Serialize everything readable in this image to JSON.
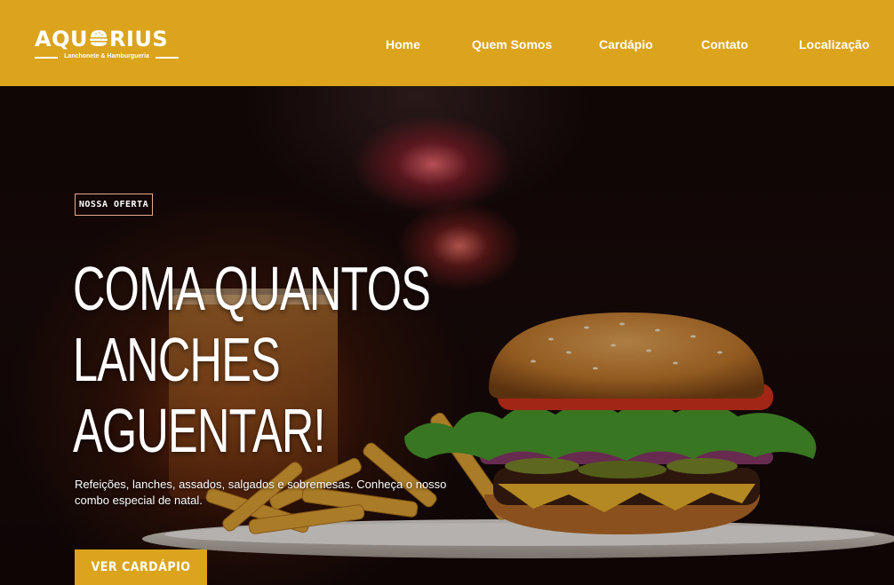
{
  "header": {
    "logo": {
      "text_left": "AQU",
      "text_right": "RIUS",
      "tagline": "Lanchonete & Hamburgueria"
    },
    "nav": [
      {
        "label": "Home"
      },
      {
        "label": "Quem Somos"
      },
      {
        "label": "Cardápio"
      },
      {
        "label": "Contato"
      },
      {
        "label": "Localização"
      }
    ]
  },
  "hero": {
    "badge": "NOSSA OFERTA",
    "headline_lines": [
      "COMA QUANTOS",
      "LANCHES",
      "AGUENTAR!"
    ],
    "description": "Refeições, lanches, assados, salgados e sobremesas. Conheça o nosso combo especial de natal.",
    "cta_label": "VER CARDÁPIO"
  },
  "colors": {
    "brand_yellow": "#dba41c",
    "text_white": "#ffffff",
    "badge_border": "#e8a98e"
  },
  "icons": {
    "logo_mark": "burger-icon"
  }
}
